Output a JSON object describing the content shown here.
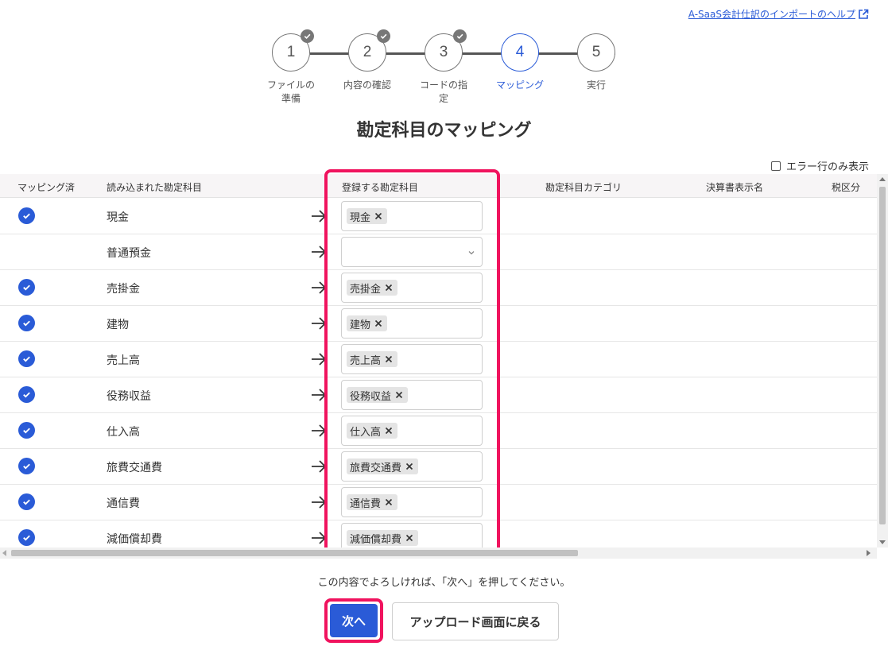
{
  "help_link": "A-SaaS会計仕訳のインポートのヘルプ",
  "stepper": {
    "steps": [
      {
        "number": "1",
        "label": "ファイルの準備",
        "completed": true
      },
      {
        "number": "2",
        "label": "内容の確認",
        "completed": true
      },
      {
        "number": "3",
        "label": "コードの指定",
        "completed": true
      },
      {
        "number": "4",
        "label": "マッピング",
        "completed": false,
        "active": true
      },
      {
        "number": "5",
        "label": "実行",
        "completed": false
      }
    ]
  },
  "title": "勘定科目のマッピング",
  "error_filter_label": "エラー行のみ表示",
  "table": {
    "headers": {
      "mapped": "マッピング済",
      "source": "読み込まれた勘定科目",
      "target": "登録する勘定科目",
      "category": "勘定科目カテゴリ",
      "statement_name": "決算書表示名",
      "tax": "税区分"
    },
    "rows": [
      {
        "mapped": true,
        "source": "現金",
        "target": "現金"
      },
      {
        "mapped": false,
        "source": "普通預金",
        "target": ""
      },
      {
        "mapped": true,
        "source": "売掛金",
        "target": "売掛金"
      },
      {
        "mapped": true,
        "source": "建物",
        "target": "建物"
      },
      {
        "mapped": true,
        "source": "売上高",
        "target": "売上高"
      },
      {
        "mapped": true,
        "source": "役務収益",
        "target": "役務収益"
      },
      {
        "mapped": true,
        "source": "仕入高",
        "target": "仕入高"
      },
      {
        "mapped": true,
        "source": "旅費交通費",
        "target": "旅費交通費"
      },
      {
        "mapped": true,
        "source": "通信費",
        "target": "通信費"
      },
      {
        "mapped": true,
        "source": "減価償却費",
        "target": "減価償却費"
      }
    ]
  },
  "confirm_text": "この内容でよろしければ、「次へ」を押してください。",
  "buttons": {
    "next": "次へ",
    "back": "アップロード画面に戻る"
  },
  "colors": {
    "accent": "#2a5bd7",
    "highlight": "#f0135e"
  }
}
